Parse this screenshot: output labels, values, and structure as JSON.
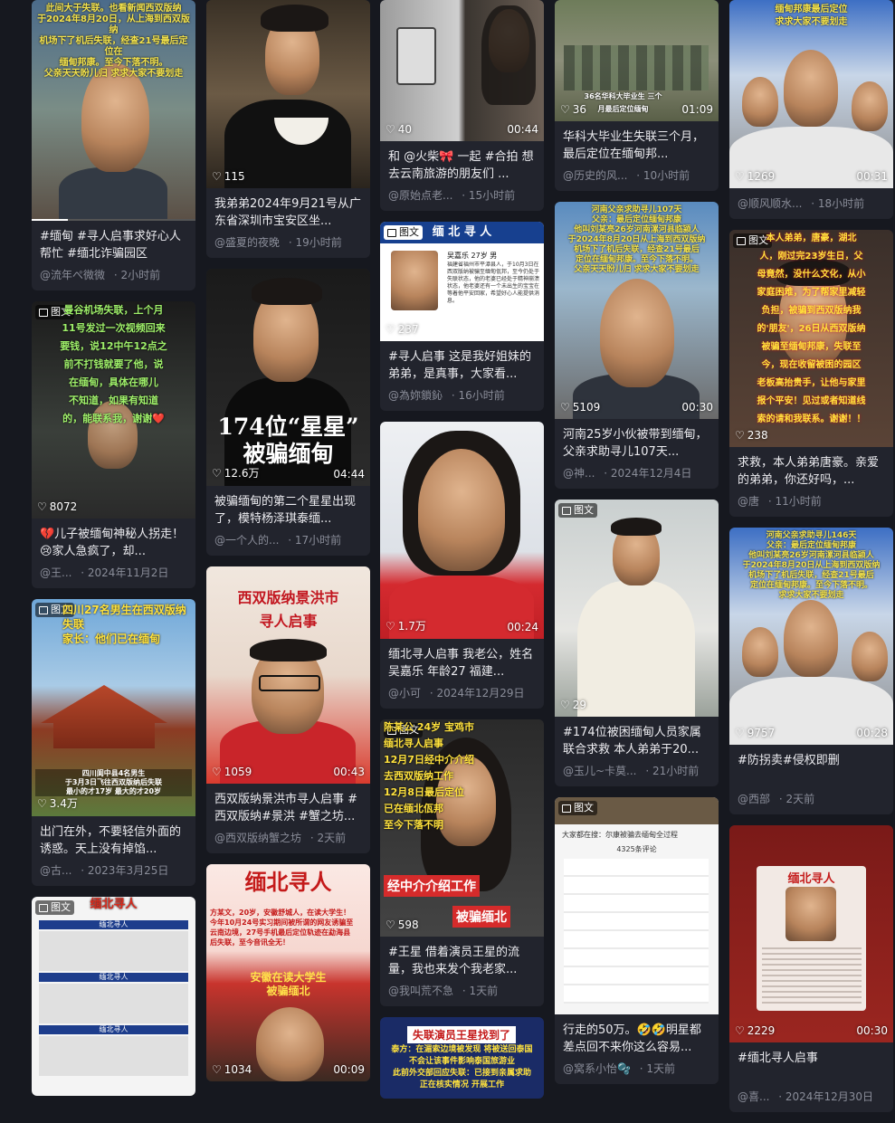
{
  "feed": {
    "col1": [
      {
        "overlay": "此间大于失联。也看新闻西双版纳\n于2024年8月20日，从上海到西双版纳\n机场下了机后失联，经查21号最后定位在\n缅甸邦康。至今下落不明。\n父亲天天盼儿归 求求大家不要划走",
        "likes": "",
        "duration": "",
        "title": "#缅甸 #寻人启事求好心人帮忙 #缅北诈骗园区",
        "author": "@流年ぺ微微",
        "time": "2小时前"
      },
      {
        "tag": "图文",
        "overlay": "曼谷机场失联，上个月\n11号发过一次视频回来\n要钱，说12中午12点之\n前不打钱就要了他，说\n在缅甸，具体在哪儿\n不知道，如果有知道\n的，能联系我，谢谢❤️",
        "likes": "8072",
        "duration": "",
        "title": "💔儿子被缅甸神秘人拐走！😢家人急疯了，却...",
        "author": "@王...",
        "time": "2024年11月2日"
      },
      {
        "tag": "图文",
        "overlay": "四川27名男生在西双版纳失联\n家长：他们已在缅甸",
        "bottom_caption": "四川阆中县4名男生\n于3月3日飞往西双版纳后失联\n最小的才17岁 最大的才20岁",
        "likes": "3.4万",
        "duration": "",
        "title": "出门在外，不要轻信外面的诱惑。天上没有掉馅...",
        "author": "@古...",
        "time": "2023年3月25日"
      },
      {
        "tag": "图文",
        "overlay": "缅北寻人",
        "rows": [
          "缅北寻人",
          "缅北寻人",
          "缅北寻人"
        ],
        "likes": "",
        "duration": "",
        "title": "",
        "author": "",
        "time": ""
      }
    ],
    "col2": [
      {
        "likes": "115",
        "duration": "",
        "title": "我弟弟2024年9月21号从广东省深圳市宝安区坐...",
        "author": "@盛夏的夜晚",
        "time": "19小时前"
      },
      {
        "caption": "174位“星星”\n被骗缅甸",
        "likes": "12.6万",
        "duration": "04:44",
        "title": "被骗缅甸的第二个星星出现了，模特杨泽琪泰缅...",
        "author": "@一个人的...",
        "time": "17小时前"
      },
      {
        "caption": "西双版纳景洪市\n寻人启事",
        "likes": "1059",
        "duration": "00:43",
        "title": "西双版纳景洪市寻人启事 #西双版纳#景洪 #蟹之坊...",
        "author": "@西双版纳蟹之坊",
        "time": "2天前"
      },
      {
        "caption": "缅北寻人",
        "body": "方某文，20岁，安徽舒城人，在读大学生！\n今年10月24号实习期间被所谓的网友诱骗至\n云南边境，27号手机最后定位轨迹在勐海县\n后失联，至今音讯全无！",
        "sub": "安徽在读大学生\n被骗缅北",
        "likes": "1034",
        "duration": "00:09",
        "title": "",
        "author": "",
        "time": ""
      }
    ],
    "col3": [
      {
        "likes": "40",
        "duration": "00:44",
        "title": "和 @火柴🎀 一起 #合拍 想去云南旅游的朋友们 ...",
        "author": "@原始点老...",
        "time": "15小时前"
      },
      {
        "tag": "图文",
        "header": "缅 北 寻 人",
        "person": "吴嘉乐  27岁  男",
        "desc": "福建省福州市平潭县人，于10月3日在西双版纳被骗至缅甸佤邦，至今仍处于失联状态，他的老婆已经处于精神崩溃状态，他老婆还有一个未出生的宝宝在等着他平安回家，希望好心人能提供消息。",
        "likes": "237",
        "duration": "",
        "title": "#寻人启事 这是我好姐妹的弟弟，是真事，大家看...",
        "author": "@為妳鎖鈊",
        "time": "16小时前"
      },
      {
        "likes": "1.7万",
        "duration": "00:24",
        "title": "缅北寻人启事 我老公，姓名 吴嘉乐 年龄27 福建...",
        "author": "@小可",
        "time": "2024年12月29日"
      },
      {
        "tag": "图文",
        "overlay": "陈某公 24岁 宝鸡市\n缅北寻人启事\n12月7日经中介介绍\n去西双版纳工作\n12月8日最后定位\n已在缅北佤邦\n至今下落不明",
        "caption1": "经中介介绍工作",
        "caption2": "被骗缅北",
        "likes": "598",
        "duration": "",
        "title": "#王星 借着演员王星的流量，我也来发个我老家...",
        "author": "@我叫荒不急",
        "time": "1天前"
      },
      {
        "header": "失联演员王星找到了",
        "body": "泰方：在湄索边境被发现 将被送回泰国\n不会让该事件影响泰国旅游业\n此前外交部回应失联：已接到亲属求助\n正在核实情况 开展工作",
        "likes": "",
        "duration": "",
        "title": "",
        "author": "",
        "time": ""
      }
    ],
    "col4": [
      {
        "overlay": "36名华科大毕业生 三个月最后定位缅甸",
        "likes": "36",
        "duration": "01:09",
        "title": "华科大毕业生失联三个月，最后定位在缅甸邦...",
        "author": "@历史的风...",
        "time": "10小时前"
      },
      {
        "overlay": "河南父亲求助寻儿107天\n父亲：最后定位缅甸邦康\n他叫刘某亮26岁河南漯河县临颍人\n于2024年8月20日从上海到西双版纳\n机场下了机后失联，经查21号最后\n定位在缅甸邦康。至今下落不明。\n父亲天天盼儿归 求求大家不要划走",
        "likes": "5109",
        "duration": "00:30",
        "title": "河南25岁小伙被带到缅甸，父亲求助寻儿107天...",
        "author": "@神...",
        "time": "2024年12月4日"
      },
      {
        "tag": "图文",
        "likes": "29",
        "duration": "",
        "title": "#174位被困缅甸人员家属联合求救 本人弟弟于20...",
        "author": "@玉儿~卡莫...",
        "time": "21小时前"
      },
      {
        "tag": "图文",
        "header": "大家都在搜：尔康被骗去缅甸全过程",
        "comments": "4325条评论",
        "likes": "",
        "duration": "",
        "title": "行走的50万。🤣🤣明星都差点回不来你这么容易...",
        "author": "@窝系小怡🫧",
        "time": "1天前"
      }
    ],
    "col5": [
      {
        "overlay": "缅甸邦康最后定位\n求求大家不要划走",
        "likes": "1269",
        "duration": "00:31",
        "title": "",
        "author": "@顺风顺水...",
        "time": "18小时前"
      },
      {
        "tag": "图文",
        "overlay": "本人弟弟，唐豪，湖北\n人，刚过完23岁生日，父\n母竟然，没什么文化，从小\n家庭困难，为了帮家里减轻\n负担，被骗到西双版纳我\n的'朋友'，26日从西双版纳\n被骗至缅甸邦康，失联至\n今，现在收留被困的园区\n老板高抬贵手，让他与家里\n报个平安！见过或者知道线\n索的请和我联系。谢谢！！",
        "likes": "238",
        "duration": "",
        "title": "求救，本人弟弟唐豪。亲爱的弟弟，你还好吗，...",
        "author": "@唐",
        "time": "11小时前"
      },
      {
        "overlay": "河南父亲求助寻儿146天\n父亲：最后定位缅甸邦康\n他叫刘某亮26岁河南漯河县临颍人\n于2024年8月20日从上海到西双版纳\n机场下了机后失联，经查21号最后\n定位在缅甸邦康。至今下落不明。\n求求大家不要划走",
        "likes": "9757",
        "duration": "00:28",
        "title": "#防拐卖#侵权即删",
        "author": "@西部",
        "time": "2天前"
      },
      {
        "header": "缅北寻人",
        "likes": "2229",
        "duration": "00:30",
        "title": "#缅北寻人启事",
        "author": "@喜...",
        "time": "2024年12月30日"
      }
    ]
  }
}
